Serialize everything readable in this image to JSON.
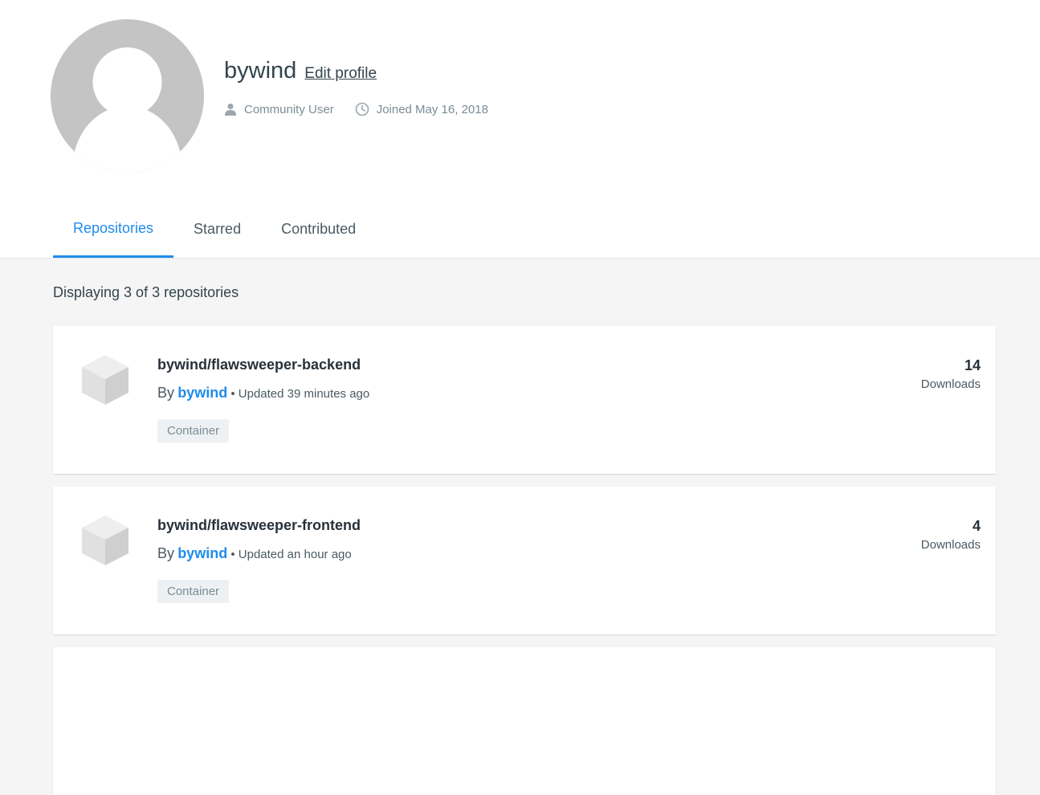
{
  "profile": {
    "username": "bywind",
    "edit_label": "Edit profile",
    "role": "Community User",
    "joined": "Joined May 16, 2018"
  },
  "tabs": [
    {
      "label": "Repositories",
      "active": true
    },
    {
      "label": "Starred",
      "active": false
    },
    {
      "label": "Contributed",
      "active": false
    }
  ],
  "listing": {
    "count_text": "Displaying 3 of 3 repositories"
  },
  "repos": [
    {
      "name": "bywind/flawsweeper-backend",
      "by": "By",
      "owner": "bywind",
      "updated": "• Updated 39 minutes ago",
      "badge": "Container",
      "downloads": "14",
      "downloads_label": "Downloads"
    },
    {
      "name": "bywind/flawsweeper-frontend",
      "by": "By",
      "owner": "bywind",
      "updated": "• Updated an hour ago",
      "badge": "Container",
      "downloads": "4",
      "downloads_label": "Downloads"
    }
  ],
  "colors": {
    "accent": "#1f8ceb",
    "avatar": "#c4c4c4",
    "background": "#f5f5f5"
  },
  "icons": {
    "role": "user-icon",
    "joined": "clock-icon",
    "repo": "cube-icon"
  }
}
